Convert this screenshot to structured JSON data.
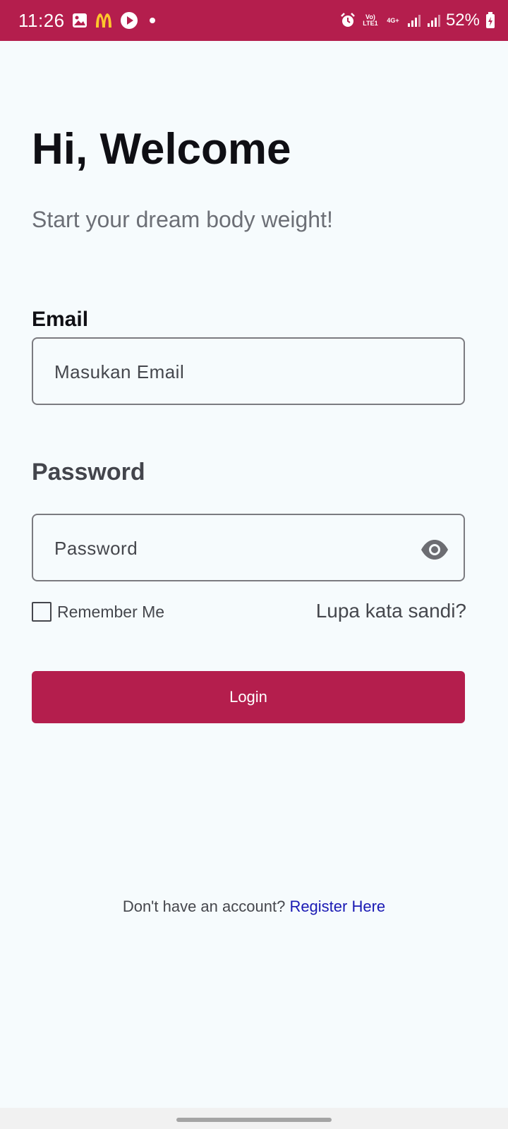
{
  "status_bar": {
    "time": "11:26",
    "battery": "52%",
    "network_label": "Vo) LTE1",
    "network_type": "4G+",
    "icons": [
      "gallery-icon",
      "mcdonalds-icon",
      "play-icon",
      "dot-icon",
      "alarm-icon",
      "signal-icon",
      "signal-icon",
      "battery-icon"
    ]
  },
  "welcome": {
    "title": "Hi, Welcome",
    "subtitle": "Start your dream body weight!"
  },
  "email": {
    "label": "Email",
    "placeholder": "Masukan Email",
    "value": ""
  },
  "password": {
    "label": "Password",
    "placeholder": "Password",
    "value": "",
    "toggle_icon": "eye-icon"
  },
  "options": {
    "remember_label": "Remember Me",
    "remember_checked": false,
    "forgot_label": "Lupa kata sandi?"
  },
  "login": {
    "button_label": "Login"
  },
  "register": {
    "prompt": "Don't have an account?",
    "link": "Register Here"
  },
  "colors": {
    "accent": "#b41e4d",
    "background": "#f6fbfd",
    "link": "#1a1ab4"
  }
}
